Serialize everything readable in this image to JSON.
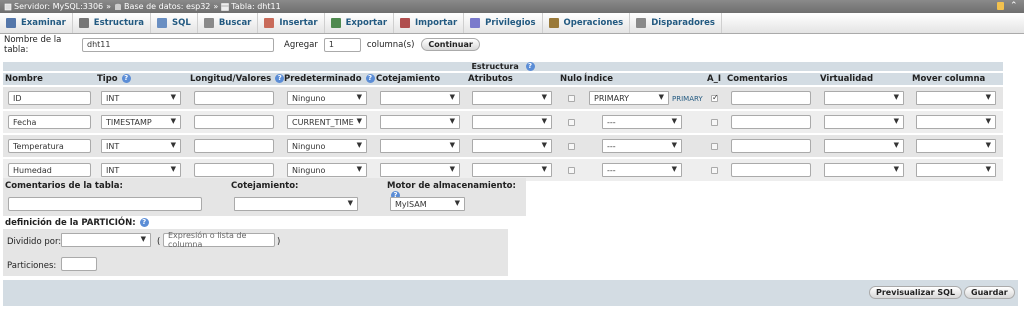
{
  "breadcrumb": {
    "server": "Servidor: MySQL:3306",
    "database": "Base de datos: esp32",
    "table": "Tabla: dht11",
    "separator": "»"
  },
  "tabs": [
    {
      "label": "Examinar",
      "icon": "browse-icon",
      "color": "#5577aa"
    },
    {
      "label": "Estructura",
      "icon": "structure-icon",
      "color": "#777777"
    },
    {
      "label": "SQL",
      "icon": "sql-icon",
      "color": "#6a8fc2"
    },
    {
      "label": "Buscar",
      "icon": "search-icon",
      "color": "#8a8a8a"
    },
    {
      "label": "Insertar",
      "icon": "insert-icon",
      "color": "#c96b5a"
    },
    {
      "label": "Exportar",
      "icon": "export-icon",
      "color": "#4f8a4f"
    },
    {
      "label": "Importar",
      "icon": "import-icon",
      "color": "#b04f4f"
    },
    {
      "label": "Privilegios",
      "icon": "privileges-icon",
      "color": "#7a7acc"
    },
    {
      "label": "Operaciones",
      "icon": "operations-icon",
      "color": "#9a7a3a"
    },
    {
      "label": "Disparadores",
      "icon": "triggers-icon",
      "color": "#8a8a8a"
    }
  ],
  "table_name": {
    "label": "Nombre de la tabla:",
    "value": "dht11"
  },
  "add": {
    "label": "Agregar",
    "value": "1",
    "suffix": "columna(s)",
    "button": "Continuar"
  },
  "structure": {
    "caption": "Estructura",
    "headers": {
      "name": "Nombre",
      "type": "Tipo",
      "length": "Longitud/Valores",
      "default": "Predeterminado",
      "collation": "Cotejamiento",
      "attributes": "Atributos",
      "null": "Nulo",
      "index": "Índice",
      "ai": "A_I",
      "comments": "Comentarios",
      "virtuality": "Virtualidad",
      "move": "Mover columna"
    },
    "rows": [
      {
        "name": "ID",
        "type": "INT",
        "default": "Ninguno",
        "index": "PRIMARY",
        "index_note": "PRIMARY",
        "ai": true
      },
      {
        "name": "Fecha",
        "type": "TIMESTAMP",
        "default": "CURRENT_TIME",
        "index": "---",
        "index_note": "",
        "ai": false
      },
      {
        "name": "Temperatura",
        "type": "INT",
        "default": "Ninguno",
        "index": "---",
        "index_note": "",
        "ai": false
      },
      {
        "name": "Humedad",
        "type": "INT",
        "default": "Ninguno",
        "index": "---",
        "index_note": "",
        "ai": false
      }
    ]
  },
  "table_options": {
    "comments_label": "Comentarios de la tabla:",
    "collation_label": "Cotejamiento:",
    "engine_label": "Motor de almacenamiento:",
    "engine_value": "MyISAM"
  },
  "partition": {
    "title": "definición de la PARTICIÓN:",
    "divided_label": "Dividido por:",
    "expr_open": "(",
    "expr_placeholder": "Expresión o lista de columna",
    "expr_close": ")",
    "partitions_label": "Particiones:"
  },
  "footer": {
    "preview": "Previsualizar SQL",
    "save": "Guardar"
  }
}
